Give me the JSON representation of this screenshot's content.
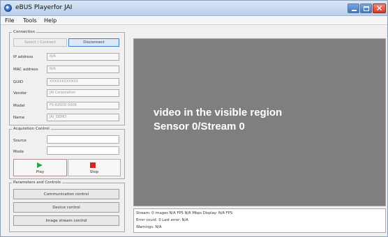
{
  "window": {
    "title": "eBUS Playerfor JAI"
  },
  "menu": {
    "file": "File",
    "tools": "Tools",
    "help": "Help"
  },
  "connection": {
    "group_label": "Connection",
    "select_connect": "Select / Connect",
    "disconnect": "Disconnect",
    "fields": [
      {
        "label": "IP address",
        "value": "N/A"
      },
      {
        "label": "MAC address",
        "value": "N/A"
      },
      {
        "label": "GUID",
        "value": "XXXXXXXXXXXX"
      },
      {
        "label": "Vendor",
        "value": "JAI Corporation"
      },
      {
        "label": "Model",
        "value": "FS-8200D-S008"
      },
      {
        "label": "Name",
        "value": "JAI_DEMO"
      }
    ]
  },
  "acquisition": {
    "group_label": "Acquisition  Control",
    "source_label": "Source",
    "source_value": "",
    "mode_label": "Mode",
    "mode_value": "",
    "play": "Play",
    "stop": "Stop"
  },
  "parameters": {
    "group_label": "Parameters  and  Controls",
    "communication": "Communication  control",
    "device": "Device control",
    "image_stream": "Image stream control"
  },
  "video": {
    "line1": "video in the visible region",
    "line2": "Sensor 0/Stream 0"
  },
  "status": {
    "line1": "Stream: 0 images   N/A FPS    N/A Mbps    Display:  N/A FPS",
    "line2": "Error count:  0    Last error:  N/A",
    "line3": "Warnings:  N/A"
  },
  "colors": {
    "video_bg": "#7f7f7f",
    "play_icon": "#1fae3a",
    "stop_icon": "#d9261c",
    "close_button": "#d23a24"
  }
}
